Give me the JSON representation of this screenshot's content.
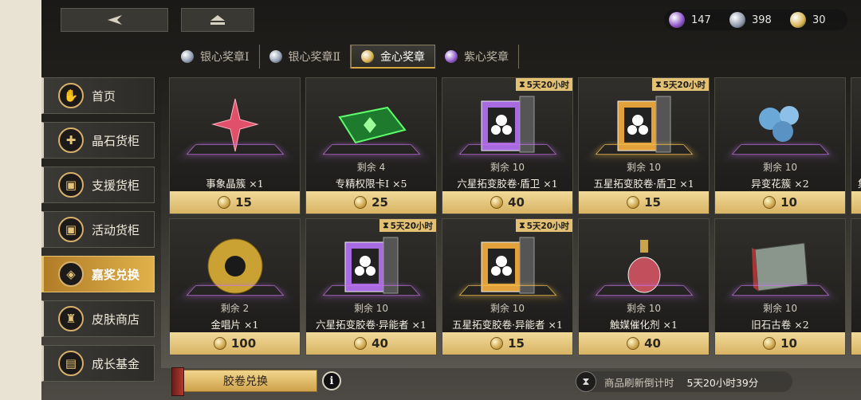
{
  "nav": {
    "back_icon": "back-arrow-icon",
    "home_icon": "eject-home-icon"
  },
  "currencies": [
    {
      "icon": "purple-gem-icon",
      "value": "147",
      "color": "#8c52c7"
    },
    {
      "icon": "silver-gem-icon",
      "value": "398",
      "color": "#8c96a8"
    },
    {
      "icon": "gold-coin-icon",
      "value": "30",
      "color": "#d6b24f"
    }
  ],
  "tabs": [
    {
      "label": "银心奖章Ⅰ",
      "color": "#8f9bb0"
    },
    {
      "label": "银心奖章Ⅱ",
      "color": "#8f9bb0"
    },
    {
      "label": "金心奖章",
      "color": "#d8b04a",
      "active": true
    },
    {
      "label": "紫心奖章",
      "color": "#8e56c9"
    }
  ],
  "sidebar": [
    {
      "label": "首页",
      "icon": "home-thumb-icon",
      "glyph": "✋"
    },
    {
      "label": "晶石货柜",
      "icon": "crystal-cabinet-icon",
      "glyph": "✚"
    },
    {
      "label": "支援货柜",
      "icon": "support-crate-icon",
      "glyph": "▣"
    },
    {
      "label": "活动货柜",
      "icon": "event-crate-icon",
      "glyph": "▣"
    },
    {
      "label": "嘉奖兑换",
      "icon": "medal-exchange-icon",
      "glyph": "◈",
      "active": true
    },
    {
      "label": "皮肤商店",
      "icon": "skin-shop-icon",
      "glyph": "♜"
    },
    {
      "label": "成长基金",
      "icon": "growth-fund-icon",
      "glyph": "▤"
    }
  ],
  "items": [
    {
      "name": "事象晶簇 ×1",
      "remain": "",
      "price": "15",
      "timer": "",
      "art": "crystal"
    },
    {
      "name": "专精权限卡Ⅰ ×5",
      "remain": "剩余 4",
      "price": "25",
      "timer": "",
      "art": "card"
    },
    {
      "name": "六星拓变胶卷·盾卫 ×1",
      "remain": "剩余 10",
      "price": "40",
      "timer": "5天20小时",
      "art": "film-purple"
    },
    {
      "name": "五星拓变胶卷·盾卫 ×1",
      "remain": "剩余 10",
      "price": "15",
      "timer": "5天20小时",
      "art": "film-gold"
    },
    {
      "name": "异变花簇 ×2",
      "remain": "剩余 10",
      "price": "10",
      "timer": "",
      "art": "flower"
    },
    {
      "name": "集",
      "remain": "",
      "price": "",
      "timer": "",
      "art": "partial"
    },
    {
      "name": "金唱片 ×1",
      "remain": "剩余 2",
      "price": "100",
      "timer": "",
      "art": "record"
    },
    {
      "name": "六星拓变胶卷·异能者 ×1",
      "remain": "剩余 10",
      "price": "40",
      "timer": "5天20小时",
      "art": "film-purple"
    },
    {
      "name": "五星拓变胶卷·异能者 ×1",
      "remain": "剩余 10",
      "price": "15",
      "timer": "5天20小时",
      "art": "film-gold"
    },
    {
      "name": "触媒催化剂 ×1",
      "remain": "剩余 10",
      "price": "40",
      "timer": "",
      "art": "bottle"
    },
    {
      "name": "旧石古卷 ×2",
      "remain": "剩余 10",
      "price": "10",
      "timer": "",
      "art": "book"
    },
    {
      "name": "",
      "remain": "",
      "price": "",
      "timer": "",
      "art": "partial"
    }
  ],
  "timer_icon": "hourglass-small-icon",
  "price_icon": "gold-coin-icon",
  "footer": {
    "exchange_label": "胶卷兑换",
    "info_glyph": "i",
    "refresh_label": "商品刷新倒计时",
    "refresh_time": "5天20小时39分"
  }
}
